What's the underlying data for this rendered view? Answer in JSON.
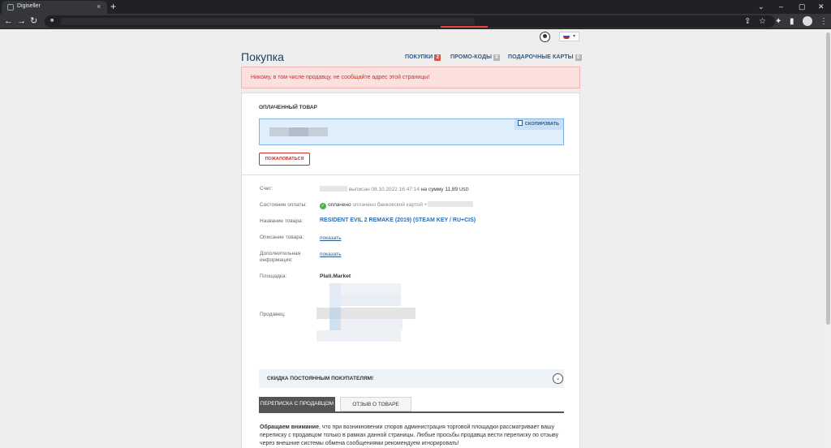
{
  "browser": {
    "tab_title": "Digiseller",
    "new_tab": "+",
    "tab_close": "×"
  },
  "header": {
    "lang_flag_colors": [
      "#ffffff",
      "#2a4fbf",
      "#d52b1e"
    ],
    "lang_caret": "▾"
  },
  "page": {
    "title": "Покупка",
    "nav": [
      {
        "label": "ПОКУПКИ",
        "badge": "2",
        "badge_color": "#d9534f"
      },
      {
        "label": "ПРОМО-КОДЫ",
        "badge": "0",
        "badge_color": "#b5b5b5"
      },
      {
        "label": "ПОДАРОЧНЫЕ КАРТЫ",
        "badge": "0",
        "badge_color": "#b5b5b5"
      }
    ],
    "warning": "Никому, в том числе продавцу, не сообщайте адрес этой страницы!"
  },
  "paid_item": {
    "title": "ОПЛАЧЕННЫЙ ТОВАР",
    "copy_label": "СКОПИРОВАТЬ",
    "complain_label": "ПОЖАЛОВАТЬСЯ"
  },
  "details": {
    "invoice_label": "Счет:",
    "invoice_issued": "выписан 08.10.2022 16:47:14",
    "invoice_sum_prefix": "на сумму",
    "invoice_amount": "11,89",
    "invoice_currency": "USD",
    "payment_label": "Состояние оплаты:",
    "payment_status": "оплачено",
    "payment_method": "оплачено банковской картой +",
    "product_label": "Название товара:",
    "product_name": "RESIDENT EVIL 2 REMAKE (2019) (STEAM KEY / RU+CIS)",
    "description_label": "Описание товара:",
    "description_link": "показать",
    "additional_label_1": "Дополнительная",
    "additional_label_2": "информация:",
    "additional_link": "показать",
    "platform_label": "Площадка:",
    "platform_value": "Plati.Market",
    "seller_label": "Продавец:"
  },
  "loyalty": {
    "title": "СКИДКА ПОСТОЯННЫМ ПОКУПАТЕЛЯМ!",
    "chevron": "⌄"
  },
  "tabs": [
    {
      "label": "ПЕРЕПИСКА С ПРОДАВЦОМ",
      "active": true
    },
    {
      "label": "ОТЗЫВ О ТОВАРЕ",
      "active": false
    }
  ],
  "notice": {
    "bold": "Обращаем внимание",
    "text": ", что при возникновении споров администрация торговой площадки рассматривает вашу переписку с продавцом только в рамках данной страницы. Любые просьбы продавца вести переписку по отзыву через внешние системы обмена сообщениями рекомендуем игнорировать!"
  }
}
